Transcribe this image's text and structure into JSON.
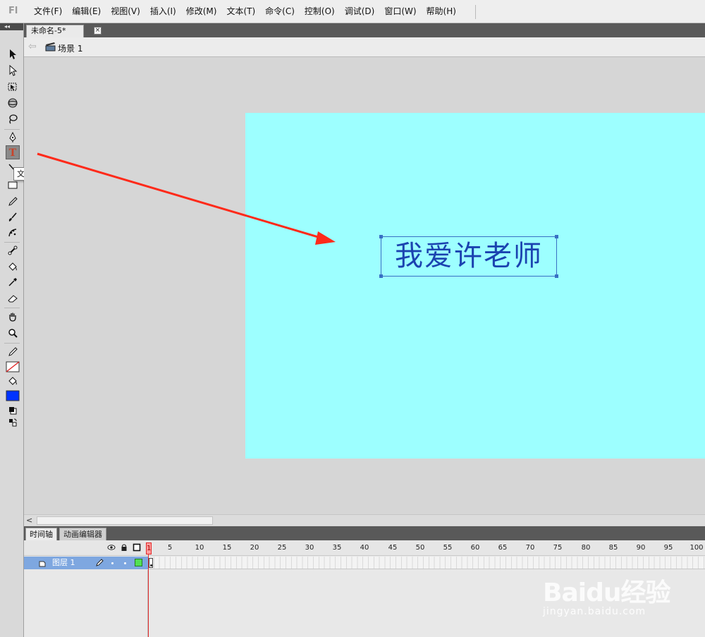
{
  "menubar": {
    "app_logo": "Fl",
    "items": [
      "文件(F)",
      "编辑(E)",
      "视图(V)",
      "插入(I)",
      "修改(M)",
      "文本(T)",
      "命令(C)",
      "控制(O)",
      "调试(D)",
      "窗口(W)",
      "帮助(H)"
    ]
  },
  "toolbar": {
    "collapse_glyph": "◂◂",
    "tooltip": "文本工具(T)",
    "tools": [
      "selection-tool-icon",
      "subselection-tool-icon",
      "free-transform-tool-icon",
      "3d-rotation-tool-icon",
      "lasso-tool-icon",
      "pen-tool-icon",
      "text-tool-icon",
      "line-tool-icon",
      "rectangle-tool-icon",
      "pencil-tool-icon",
      "brush-tool-icon",
      "deco-tool-icon",
      "bone-tool-icon",
      "paint-bucket-tool-icon",
      "eyedropper-tool-icon",
      "eraser-tool-icon",
      "hand-tool-icon",
      "zoom-tool-icon",
      "stroke-color-icon",
      "fill-color-icon",
      "black-white-icon",
      "swap-colors-icon"
    ],
    "stroke_color": "none",
    "fill_color": "#0033ff"
  },
  "document": {
    "tab_title": "未命名-5*",
    "tab_close": "×",
    "scene_label": "场景 1",
    "stage_color": "#9dffff",
    "text_content": "我爱许老师",
    "text_color": "#1b43b0"
  },
  "scrollbar": {
    "left_arrow": "<"
  },
  "panels": {
    "tabs": [
      "时间轴",
      "动画编辑器"
    ]
  },
  "timeline": {
    "ruler": [
      "1",
      "5",
      "10",
      "15",
      "20",
      "25",
      "30",
      "35",
      "40",
      "45",
      "50",
      "55",
      "60",
      "65",
      "70",
      "75",
      "80",
      "85",
      "90",
      "95",
      "100"
    ],
    "layer_name": "图层 1",
    "layer_color": "#53e053",
    "current_frame": "1"
  },
  "watermark": {
    "logo": "Baidu经验",
    "url": "jingyan.baidu.com"
  },
  "annotation": {
    "arrow_color": "#ff2a1a"
  }
}
